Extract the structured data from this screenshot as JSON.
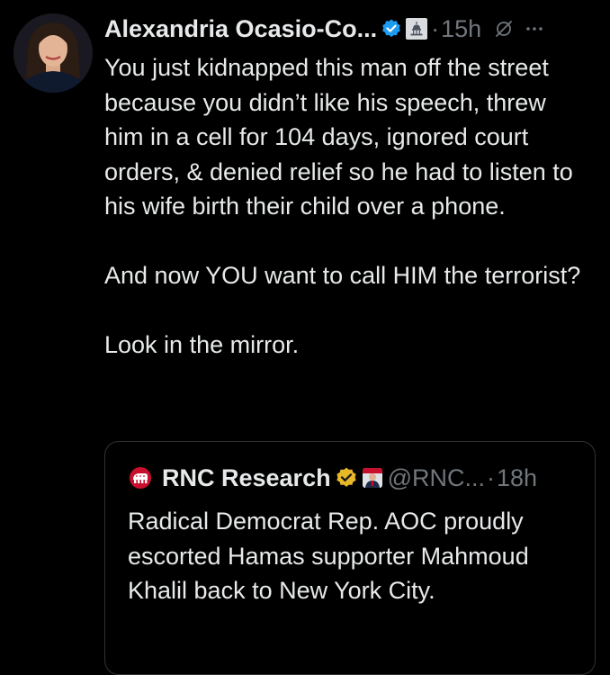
{
  "tweet": {
    "author_name": "Alexandria Ocasio-Co...",
    "separator": "·",
    "timestamp": "15h",
    "more_label": "···",
    "paragraphs": [
      "You just kidnapped this man off the street because you didn’t like his speech, threw him in a cell for 104 days, ignored court orders, & denied relief so he had to listen to his wife birth their child over a phone.",
      "And now YOU want to call HIM the terrorist?",
      "Look in the mirror."
    ],
    "icons": {
      "verified": "verified-badge-icon",
      "government": "capitol-building-icon",
      "grok": "grok-icon",
      "more": "more-dots-icon"
    }
  },
  "quote": {
    "author_name": "RNC Research",
    "handle": "@RNC...",
    "separator": "·",
    "timestamp": "18h",
    "text": "Radical Democrat Rep. AOC proudly escorted Hamas supporter Mahmoud Khalil back to New York City.",
    "icons": {
      "avatar": "republican-elephant-logo-icon",
      "verified": "gold-verified-badge-icon",
      "affiliation": "affiliate-avatar-icon"
    }
  },
  "colors": {
    "background": "#000000",
    "text_primary": "#e7e9ea",
    "text_secondary": "#71767b",
    "verified_blue": "#1d9bf0",
    "verified_gold": "#e8b829",
    "border": "#2f3336",
    "rnc_red": "#c8102e"
  }
}
